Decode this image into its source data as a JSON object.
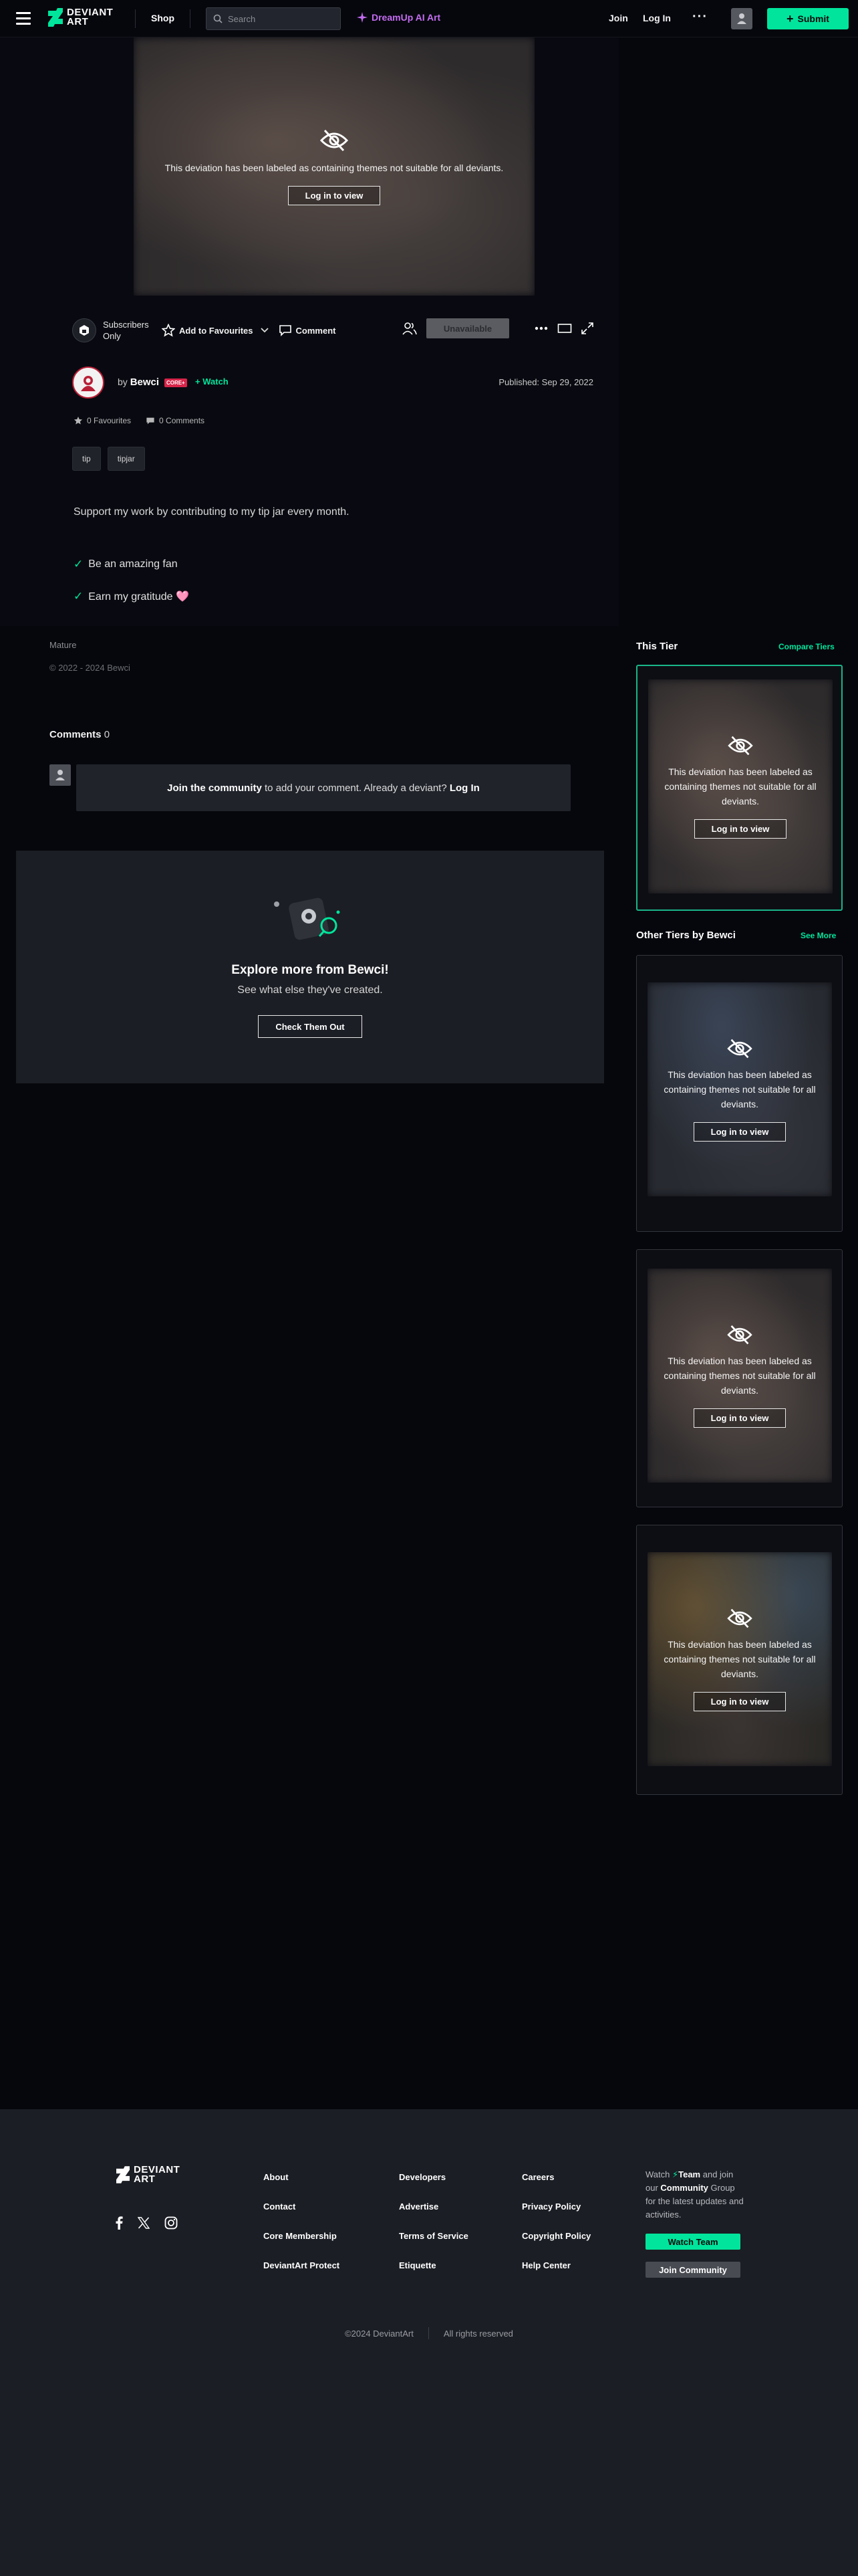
{
  "header": {
    "logo_text_1": "DEVIANT",
    "logo_text_2": "ART",
    "shop": "Shop",
    "search_placeholder": "Search",
    "dreamup": "DreamUp AI Art",
    "join": "Join",
    "login": "Log In",
    "more": "···",
    "submit": "Submit"
  },
  "deviation": {
    "mature_message": "This deviation has been labeled as containing themes not suitable for all deviants.",
    "login_to_view": "Log in to view",
    "subscribers_only": "Subscribers Only",
    "add_to_favourites": "Add to Favourites",
    "comment": "Comment",
    "unavailable": "Unavailable",
    "by": "by",
    "author": "Bewci",
    "core_badge": "CORE+",
    "watch": "Watch",
    "published": "Published: Sep 29, 2022",
    "favourites": "0 Favourites",
    "comments_count": "0 Comments",
    "tags": [
      "tip",
      "tipjar"
    ],
    "description": "Support my work by contributing to my tip jar every month.",
    "perks": [
      "Be an amazing fan",
      "Earn my gratitude 🩷"
    ],
    "mature_label": "Mature",
    "copyright": "© 2022 - 2024 Bewci"
  },
  "comments": {
    "title": "Comments",
    "count": "0",
    "join_community": "Join the community",
    "prompt_middle": " to add your comment. Already a deviant? ",
    "login": "Log In"
  },
  "explore": {
    "title": "Explore more from Bewci!",
    "subtitle": "See what else they've created.",
    "button": "Check Them Out"
  },
  "sidebar": {
    "this_tier": "This Tier",
    "compare_tiers": "Compare Tiers",
    "other_tiers": "Other Tiers by Bewci",
    "see_more": "See More"
  },
  "footer": {
    "logo_text_1": "DEVIANT",
    "logo_text_2": "ART",
    "col1": [
      "About",
      "Contact",
      "Core Membership",
      "DeviantArt Protect"
    ],
    "col2": [
      "Developers",
      "Advertise",
      "Terms of Service",
      "Etiquette"
    ],
    "col3": [
      "Careers",
      "Privacy Policy",
      "Copyright Policy",
      "Help Center"
    ],
    "watch_prefix": "Watch ",
    "team": "Team",
    "watch_mid": " and join our ",
    "community": "Community",
    "watch_suffix": " Group for the latest updates and activities.",
    "watch_team_btn": "Watch Team",
    "join_community_btn": "Join Community",
    "copyright": "©2024 DeviantArt",
    "rights": "All rights reserved"
  },
  "colors": {
    "accent": "#00e59b",
    "background": "#06070d",
    "dreamup": "#c46cf0"
  }
}
